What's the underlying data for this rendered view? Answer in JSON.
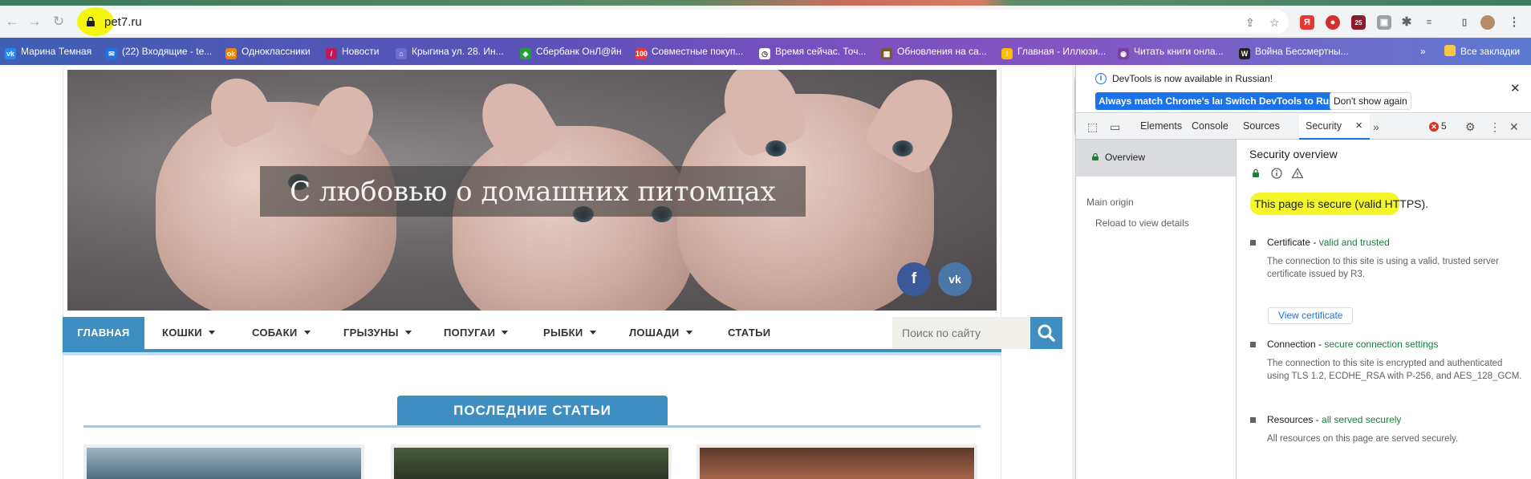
{
  "browser": {
    "url": "pet7.ru",
    "bookmarks": [
      {
        "label": "Марина Темная",
        "color": "#2787f5",
        "glyph": "vk"
      },
      {
        "label": "(22) Входящие - te...",
        "color": "#1a73e8",
        "glyph": "✉"
      },
      {
        "label": "Одноклассники",
        "color": "#ee8208",
        "glyph": "ok"
      },
      {
        "label": "Новости",
        "color": "#c2185b",
        "glyph": "/"
      },
      {
        "label": "Крыгина ул. 28. Ин...",
        "color": "#6a6fd1",
        "glyph": "⌂"
      },
      {
        "label": "Сбербанк ОнЛ@йн",
        "color": "#21a038",
        "glyph": "◆"
      },
      {
        "label": "Совместные покуп...",
        "color": "#e53935",
        "glyph": "100"
      },
      {
        "label": "Время сейчас. Точ...",
        "color": "#ffffff",
        "glyph": "◷"
      },
      {
        "label": "Обновления на са...",
        "color": "#7b5a2a",
        "glyph": "▦"
      },
      {
        "label": "Главная - Иллюзи...",
        "color": "#fbbc05",
        "glyph": "!"
      },
      {
        "label": "Читать книги онла...",
        "color": "#7b3fa0",
        "glyph": "◉"
      },
      {
        "label": "Война Бессмертны...",
        "color": "#222222",
        "glyph": "W"
      }
    ],
    "more_bookmarks": "»",
    "all_bookmarks": "Все закладки",
    "extension_badge": "25"
  },
  "site": {
    "banner_title": "С любовью о домашних питомцах",
    "social": [
      "f",
      "vk"
    ],
    "nav": {
      "home": "ГЛАВНАЯ",
      "items": [
        "КОШКИ",
        "СОБАКИ",
        "ГРЫЗУНЫ",
        "ПОПУГАИ",
        "РЫБКИ",
        "ЛОШАДИ",
        "СТАТЬИ"
      ],
      "search_placeholder": "Поиск по сайту"
    },
    "latest_title": "ПОСЛЕДНИЕ СТАТЬИ"
  },
  "devtools": {
    "info_text": "DevTools is now available in Russian!",
    "info_buttons": [
      "Always match Chrome's language",
      "Switch DevTools to Russian",
      "Don't show again"
    ],
    "tabs": [
      "Elements",
      "Console",
      "Sources",
      "Security"
    ],
    "active_tab": "Security",
    "error_count": "5",
    "sidebar": {
      "overview": "Overview",
      "main_origin": "Main origin",
      "reload": "Reload to view details"
    },
    "security": {
      "title": "Security overview",
      "summary": "This page is secure (valid HTTPS).",
      "certificate": {
        "label": "Certificate - ",
        "status": "valid and trusted",
        "desc": "The connection to this site is using a valid, trusted server certificate issued by R3.",
        "button": "View certificate"
      },
      "connection": {
        "label": "Connection - ",
        "status": "secure connection settings",
        "desc": "The connection to this site is encrypted and authenticated using TLS 1.2, ECDHE_RSA with P-256, and AES_128_GCM."
      },
      "resources": {
        "label": "Resources - ",
        "status": "all served securely",
        "desc": "All resources on this page are served securely."
      }
    },
    "colors": {
      "accent": "#1a73e8",
      "secure_green": "#188038",
      "highlight": "#f4f52a"
    }
  }
}
